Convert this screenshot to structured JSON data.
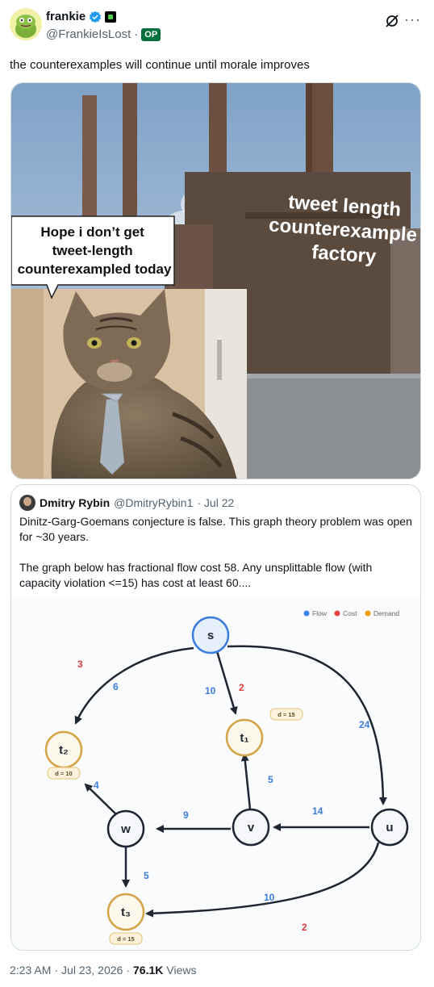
{
  "author": {
    "display_name": "frankie",
    "handle": "@FrankieIsLost",
    "op_badge": "OP",
    "separator": "·"
  },
  "tweet": {
    "text": "the counterexamples will continue until morale improves"
  },
  "meme": {
    "speech_bubble": [
      "Hope i don’t get",
      "tweet-length",
      "counterexampled today"
    ],
    "factory_label": [
      "tweet length",
      "counterexample",
      "factory"
    ]
  },
  "quote": {
    "name": "Dmitry Rybin",
    "handle": "@DmitryRybin1",
    "date": "· Jul 22",
    "para1": "Dinitz-Garg-Goemans conjecture is false. This graph theory problem was open for ~30 years.",
    "para2": "The graph below has fractional flow cost 58. Any unsplittable flow (with capacity violation <=15) has cost at least 60...."
  },
  "graph": {
    "legend": [
      {
        "label": "Flow",
        "color": "#3b82f6"
      },
      {
        "label": "Cost",
        "color": "#ef4444"
      },
      {
        "label": "Demand",
        "color": "#f59e0b"
      }
    ],
    "nodes": {
      "s": "s",
      "t1": "t₁",
      "t2": "t₂",
      "t3": "t₃",
      "w": "w",
      "v": "v",
      "u": "u"
    },
    "demands": {
      "t1": "d = 15",
      "t2": "d = 10",
      "t3": "d = 15"
    },
    "edge_labels": {
      "s_t2_cost": "3",
      "s_t2_flow": "6",
      "s_t1_flow": "10",
      "s_t1_cost": "2",
      "s_u_flow": "24",
      "w_t2_flow": "4",
      "v_t1_flow": "5",
      "v_w_flow": "9",
      "u_v_flow": "14",
      "w_t3_flow": "5",
      "u_t3_flow": "10",
      "u_t3_cost": "2"
    }
  },
  "footer": {
    "time": "2:23 AM",
    "sep1": "·",
    "date": "Jul 23, 2026",
    "sep2": "·",
    "views_count": "76.1K",
    "views_label": "Views"
  }
}
